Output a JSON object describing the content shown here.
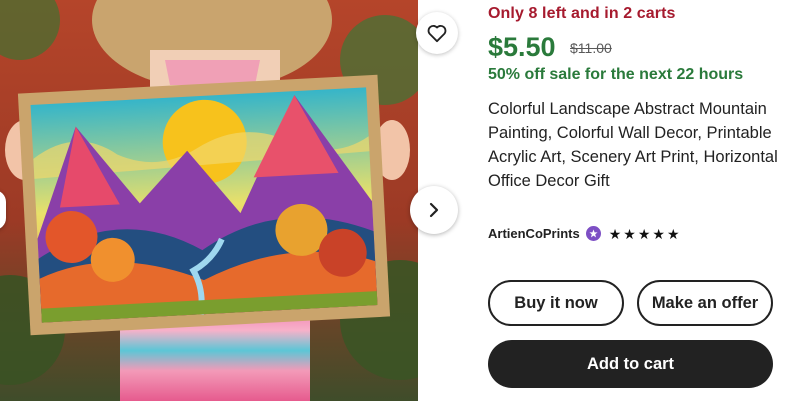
{
  "listing": {
    "stock_notice": "Only 8 left and in 2 carts",
    "price": "$5.50",
    "original_price": "$11.00",
    "sale_notice": "50% off sale for the next 22 hours",
    "title": "Colorful Landscape Abstract Mountain Painting, Colorful Wall Decor, Printable Acrylic Art, Scenery Art Print, Horizontal Office Decor Gift",
    "shop_name": "ArtienCoPrints",
    "rating_stars": 5
  },
  "actions": {
    "buy_now": "Buy it now",
    "make_offer": "Make an offer",
    "add_to_cart": "Add to cart"
  },
  "colors": {
    "stock_red": "#a61a2e",
    "price_green": "#2a7a3b",
    "button_dark": "#222222",
    "star_seller_badge": "#7d4fc4"
  },
  "icons": {
    "favorite": "heart-icon",
    "next": "chevron-right-icon",
    "badge": "star-seller-icon",
    "star": "star-icon"
  }
}
